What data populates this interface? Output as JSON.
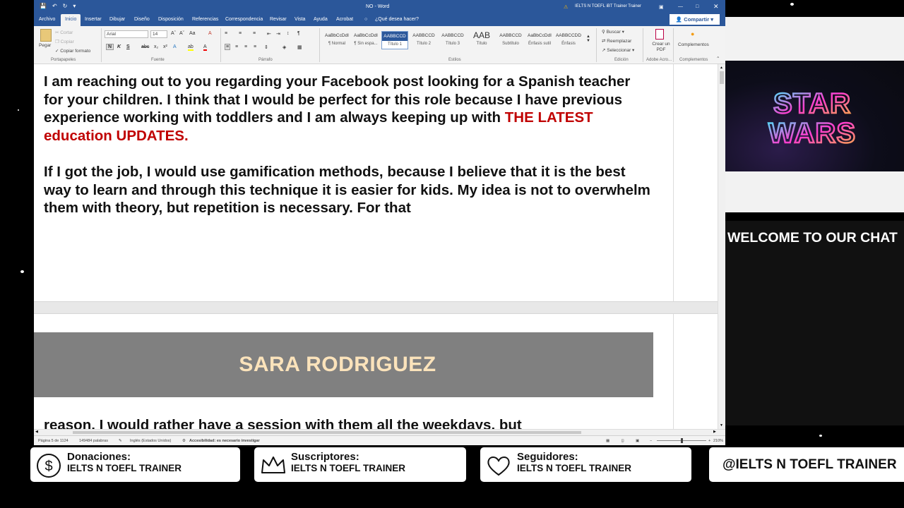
{
  "word": {
    "title": "NO  -  Word",
    "account": "IELTS N TOEFL iBT Trainer Trainer",
    "tabs": [
      "Archivo",
      "Inicio",
      "Insertar",
      "Dibujar",
      "Diseño",
      "Disposición",
      "Referencias",
      "Correspondencia",
      "Revisar",
      "Vista",
      "Ayuda",
      "Acrobat",
      "¿Qué desea hacer?"
    ],
    "active_tab": "Inicio",
    "share_label": "Compartir",
    "ribbon": {
      "paste": "Pegar",
      "cut": "Cortar",
      "copy": "Copiar",
      "format_painter": "Copiar formato",
      "clipboard_group": "Portapapeles",
      "font_name": "Arial",
      "font_size": "14",
      "font_group": "Fuente",
      "paragraph_group": "Párrafo",
      "styles_group": "Estilos",
      "styles": [
        {
          "sample": "AaBbCcDdI",
          "name": "¶ Normal"
        },
        {
          "sample": "AaBbCcDdI",
          "name": "¶ Sin espa..."
        },
        {
          "sample": "AABBCCD",
          "name": "Título 1"
        },
        {
          "sample": "AABBCCD",
          "name": "Título 2"
        },
        {
          "sample": "AABBCCD",
          "name": "Título 3"
        },
        {
          "sample": "AAB",
          "name": "Título"
        },
        {
          "sample": "AABBCCD",
          "name": "Subtítulo"
        },
        {
          "sample": "AaBbCcDdI",
          "name": "Énfasis sutil"
        },
        {
          "sample": "AABBCCDD",
          "name": "Énfasis"
        }
      ],
      "find": "Buscar",
      "replace": "Reemplazar",
      "select": "Seleccionar",
      "editing_group": "Edición",
      "create_pdf": "Crear un PDF",
      "adobe_group": "Adobe Acro...",
      "addins": "Complementos",
      "addins_group": "Complementos"
    },
    "document": {
      "paragraph1": "I am reaching out to you regarding your Facebook post looking for a Spanish teacher for your children. I think that I would be perfect for this role because I have previous experience working with toddlers and I am always keeping up with",
      "paragraph1_highlight": "THE LATEST education UPDATES.",
      "paragraph2": "If I got the job, I would use gamification methods, because I believe that it is the best way to learn and through this technique it is easier for kids. My idea is not to overwhelm them with theory, but repetition is necessary. For that",
      "banner_name": "SARA RODRIGUEZ",
      "continued": "reason, I would rather have a session with them all the weekdays, but"
    },
    "status": {
      "page": "Página 5 de 1124",
      "words": "149484 palabras",
      "language": "Inglés (Estados Unidos)",
      "accessibility": "Accesibilidad: es necesario investigar",
      "zoom": "210%"
    }
  },
  "overlay": {
    "star_wars_logo": "STAR WARS",
    "chat_title": "WELCOME TO OUR CHAT",
    "cards": [
      {
        "key": "Donaciones:",
        "value": "IELTS N TOEFL TRAINER",
        "icon": "dollar-coin-icon"
      },
      {
        "key": "Suscriptores:",
        "value": "IELTS N TOEFL TRAINER",
        "icon": "crown-icon"
      },
      {
        "key": "Seguidores:",
        "value": "IELTS N TOEFL TRAINER",
        "icon": "heart-icon"
      }
    ],
    "handle": "@IELTS N TOEFL TRAINER"
  },
  "colors": {
    "word_blue": "#2b579a",
    "highlight_red": "#c00000",
    "banner_grey": "#808080",
    "banner_text": "#fbe3bb"
  }
}
